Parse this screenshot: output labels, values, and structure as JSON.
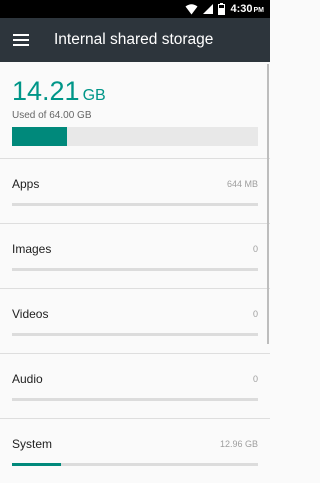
{
  "status_bar": {
    "time": "4:30",
    "ampm": "PM",
    "icons": [
      "wifi-icon",
      "signal-icon",
      "battery-icon"
    ]
  },
  "toolbar": {
    "title": "Internal shared storage",
    "menu_icon": "hamburger-menu-icon"
  },
  "summary": {
    "used_value": "14.21",
    "used_unit": "GB",
    "used_of_label": "Used of 64.00 GB",
    "used_fraction": 0.222
  },
  "categories": [
    {
      "label": "Apps",
      "size": "644 MB",
      "fraction": 0
    },
    {
      "label": "Images",
      "size": "0",
      "fraction": 0
    },
    {
      "label": "Videos",
      "size": "0",
      "fraction": 0
    },
    {
      "label": "Audio",
      "size": "0",
      "fraction": 0
    },
    {
      "label": "System",
      "size": "12.96 GB",
      "fraction": 0.2
    }
  ],
  "colors": {
    "accent": "#009688",
    "bar_fill": "#00897b",
    "toolbar": "#2d353c",
    "status_bar": "#000000"
  }
}
